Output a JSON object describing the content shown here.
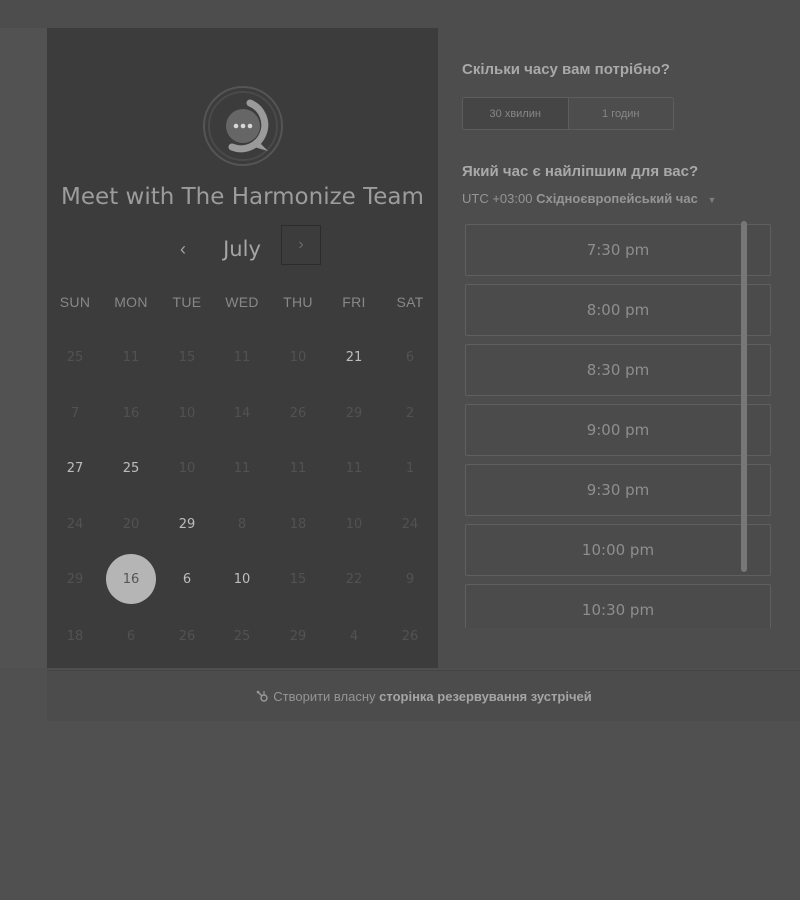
{
  "calendar": {
    "title": "Meet with The Harmonize Team",
    "month": "July",
    "prev_icon": "‹",
    "next_icon": "›",
    "weekdays": [
      "SUN",
      "MON",
      "TUE",
      "WED",
      "THU",
      "FRI",
      "SAT"
    ],
    "weeks": [
      [
        "25",
        "11",
        "15",
        "11",
        "10",
        "21",
        "6"
      ],
      [
        "7",
        "16",
        "10",
        "14",
        "26",
        "29",
        "2"
      ],
      [
        "27",
        "25",
        "10",
        "11",
        "11",
        "11",
        "1"
      ],
      [
        "24",
        "20",
        "29",
        "8",
        "18",
        "10",
        "24"
      ],
      [
        "29",
        "16",
        "6",
        "10",
        "15",
        "22",
        "9"
      ],
      [
        "18",
        "6",
        "26",
        "25",
        "29",
        "4",
        "26"
      ]
    ],
    "available": [
      "0-5",
      "2-0",
      "2-1",
      "3-2",
      "4-2",
      "4-3"
    ],
    "selected": "4-1"
  },
  "booking": {
    "duration_question": "Скільки часу вам потрібно?",
    "durations": [
      "30 хвилин",
      "1 годин"
    ],
    "active_duration": "30 хвилин",
    "time_question": "Який час є найліпшим для вас?",
    "timezone_offset": "UTC +03:00",
    "timezone_name": "Східноєвропейський час",
    "slots": [
      "7:30 pm",
      "8:00 pm",
      "8:30 pm",
      "9:00 pm",
      "9:30 pm",
      "10:00 pm",
      "10:30 pm"
    ]
  },
  "footer": {
    "prefix": "Створити власну",
    "link": "сторінка резервування зустрічей"
  },
  "colors": {
    "selected_day_bg": "#b5b5b5",
    "panel_dark": "#3c3c3c",
    "panel_light": "#4d4d4d"
  }
}
